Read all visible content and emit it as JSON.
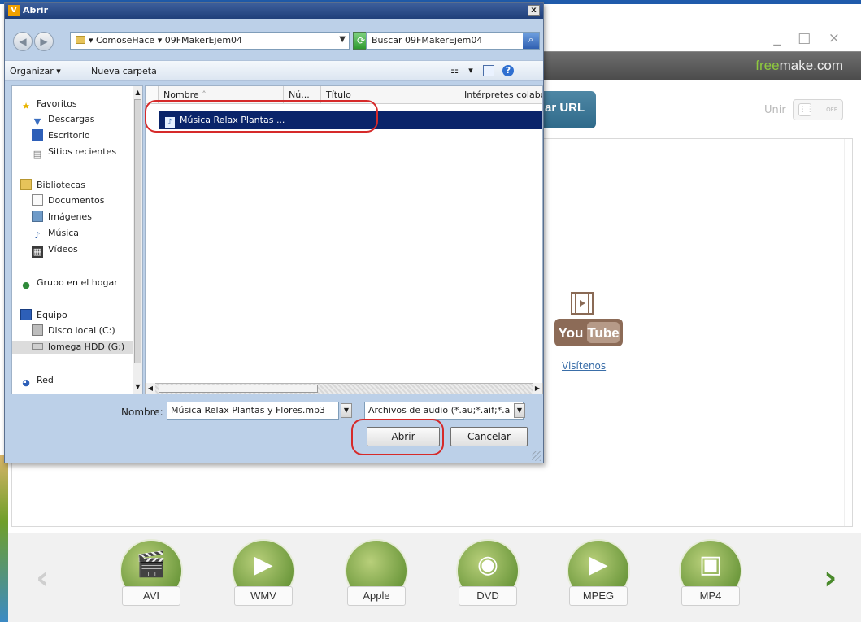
{
  "app": {
    "brand_part1": "free",
    "brand_part2": "make.com",
    "url_button": "ar URL",
    "join_label": "Unir",
    "toggle_state": "OFF",
    "window_buttons": "_ □ ×",
    "youtube_text": "You Tube",
    "youtube_link": "Visítenos",
    "formats": [
      {
        "label": "AVI",
        "icon": "clapperboard-icon",
        "glyph": "🎬"
      },
      {
        "label": "WMV",
        "icon": "windows-media-icon",
        "glyph": "▶"
      },
      {
        "label": "Apple",
        "icon": "apple-icon",
        "glyph": ""
      },
      {
        "label": "DVD",
        "icon": "disc-icon",
        "glyph": "◉"
      },
      {
        "label": "MPEG",
        "icon": "tv-icon",
        "glyph": "▶"
      },
      {
        "label": "MP4",
        "icon": "media-player-icon",
        "glyph": "▣"
      }
    ],
    "nav_prev": "‹",
    "nav_next": "›"
  },
  "dialog": {
    "title": "Abrir",
    "app_icon_letter": "V",
    "close": "x",
    "breadcrumb": "▾ ComoseHace ▾ 09FMakerEjem04",
    "search_placeholder": "Buscar 09FMakerEjem04",
    "toolbar": {
      "organize": "Organizar ▾",
      "new_folder": "Nueva carpeta"
    },
    "nav": {
      "favorites": "Favoritos",
      "downloads": "Descargas",
      "desktop": "Escritorio",
      "recent": "Sitios recientes",
      "libraries": "Bibliotecas",
      "documents": "Documentos",
      "images": "Imágenes",
      "music": "Música",
      "videos": "Vídeos",
      "homegroup": "Grupo en el hogar",
      "computer": "Equipo",
      "local_disk": "Disco local (C:)",
      "iomega": "Iomega HDD (G:)",
      "network": "Red"
    },
    "columns": {
      "name": "Nombre",
      "num": "Nú...",
      "title": "Título",
      "artists": "Intérpretes colabor"
    },
    "file": "Música Relax Plantas ...",
    "filename_label": "Nombre:",
    "filename_value": "Música Relax Plantas y Flores.mp3",
    "filetype_value": "Archivos de audio (*.au;*.aif;*.a",
    "open_button": "Abrir",
    "cancel_button": "Cancelar"
  }
}
